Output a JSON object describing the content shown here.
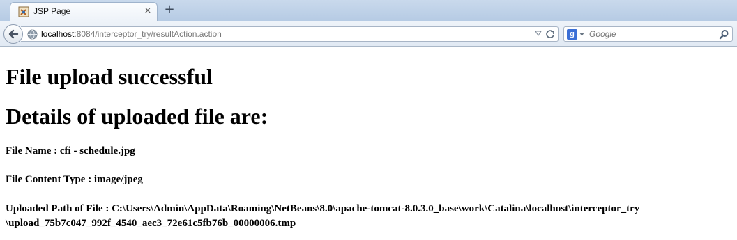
{
  "browser": {
    "tab": {
      "title": "JSP Page",
      "close_glyph": "×"
    },
    "new_tab_glyph": "+",
    "url": {
      "host": "localhost",
      "rest": ":8084/interceptor_try/resultAction.action"
    },
    "search": {
      "engine_letter": "g",
      "placeholder": "Google"
    }
  },
  "page": {
    "heading1": "File upload successful",
    "heading2": "Details of uploaded file are:",
    "file_name": "File Name : cfi - schedule.jpg",
    "content_type": "File Content Type : image/jpeg",
    "path_line1": "Uploaded Path of File : C:\\Users\\Admin\\AppData\\Roaming\\NetBeans\\8.0\\apache-tomcat-8.0.3.0_base\\work\\Catalina\\localhost\\interceptor_try",
    "path_line2": "\\upload_75b7c047_992f_4540_aec3_72e61c5fb76b_00000006.tmp"
  },
  "icons": {
    "favicon": "java-cup-icon",
    "back": "back-arrow-icon",
    "globe": "globe-icon",
    "dropdown": "dropdown-arrow-icon",
    "reload": "reload-icon",
    "search_go": "magnifier-icon"
  }
}
